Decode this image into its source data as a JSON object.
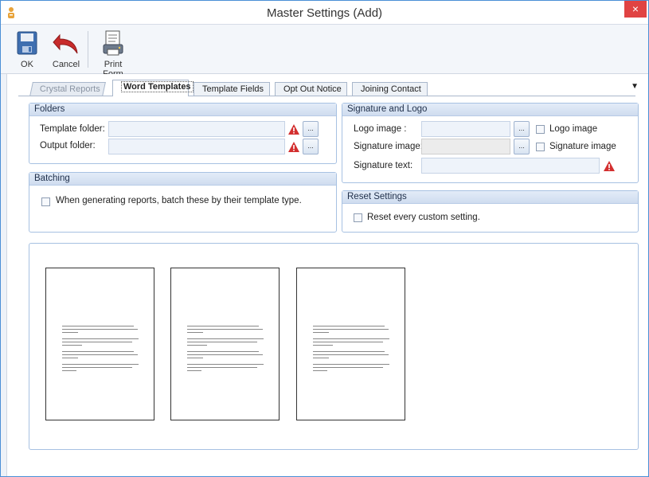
{
  "window": {
    "title": "Master Settings (Add)",
    "close_glyph": "×"
  },
  "toolbar": {
    "ok_label": "OK",
    "cancel_label": "Cancel",
    "print_form_label": "Print Form"
  },
  "tabs": [
    {
      "label": "Crystal Reports",
      "state": "disabled"
    },
    {
      "label": "Word Templates",
      "state": "active"
    },
    {
      "label": "Template Fields",
      "state": "normal"
    },
    {
      "label": "Opt Out Notice",
      "state": "normal"
    },
    {
      "label": "Joining Contact",
      "state": "normal"
    }
  ],
  "tab_overflow_glyph": "▼",
  "folders": {
    "header": "Folders",
    "template_label": "Template folder:",
    "template_value": "",
    "output_label": "Output folder:",
    "output_value": "",
    "browse_label": "..."
  },
  "batching": {
    "header": "Batching",
    "checkbox_label": "When generating reports, batch these by their template type.",
    "checked": false
  },
  "signature_logo": {
    "header": "Signature and Logo",
    "logo_label": "Logo image :",
    "logo_value": "",
    "logo_check_label": "Logo image",
    "signature_label": "Signature image:",
    "signature_value": "",
    "signature_check_label": "Signature image",
    "sigtext_label": "Signature text:",
    "sigtext_value": "",
    "browse_label": "..."
  },
  "reset": {
    "header": "Reset Settings",
    "checkbox_label": "Reset every custom setting.",
    "checked": false
  },
  "previews": [
    {
      "name": "template-preview-1"
    },
    {
      "name": "template-preview-2"
    },
    {
      "name": "template-preview-3"
    }
  ],
  "colors": {
    "accent": "#4a8fd6",
    "group_border": "#a7c1e2",
    "close_red": "#e04343",
    "warning_red": "#d32f2f"
  },
  "icons": [
    "app-icon",
    "save-icon",
    "undo-icon",
    "print-form-icon",
    "warning-icon",
    "close-icon"
  ]
}
